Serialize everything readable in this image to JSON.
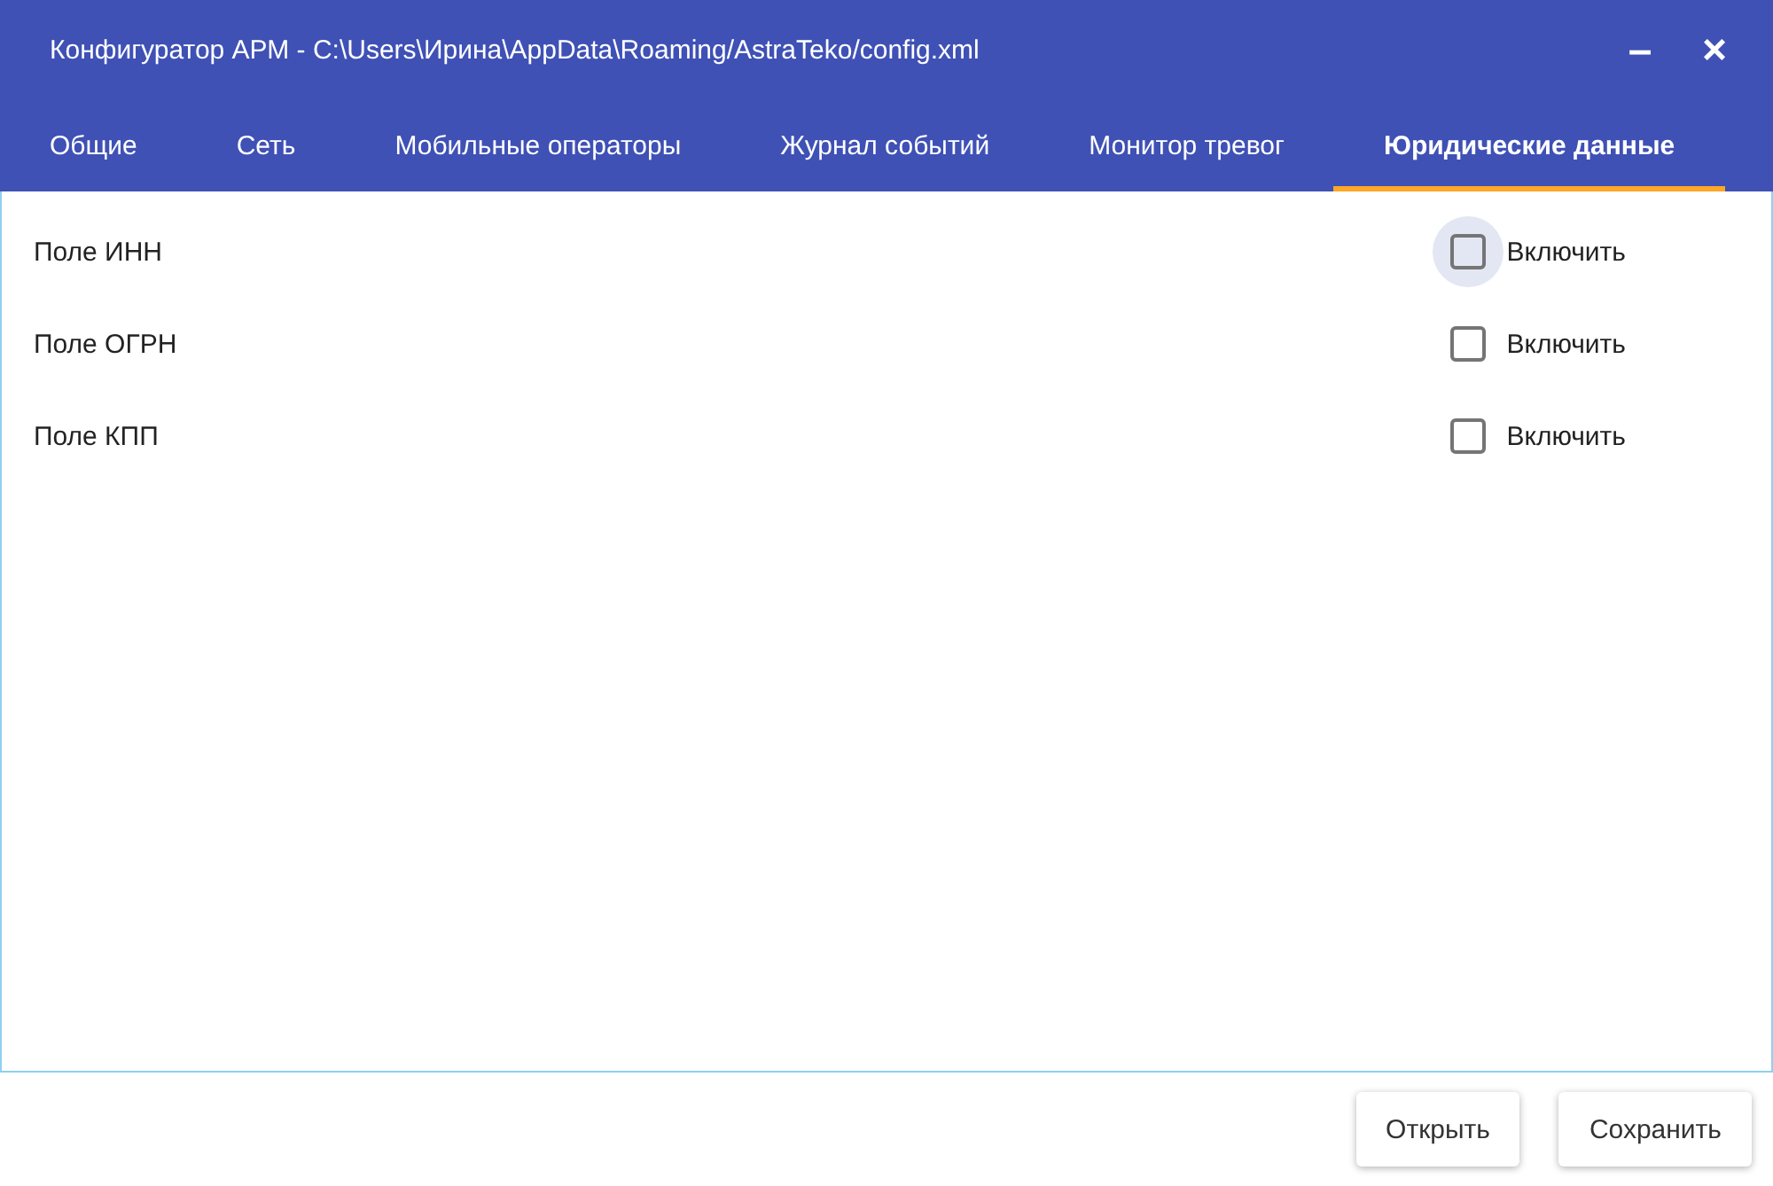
{
  "window": {
    "title": "Конфигуратор АРМ - C:\\Users\\Ирина\\AppData\\Roaming/AstraTeko/config.xml",
    "minimize": "–",
    "close": "×"
  },
  "tabs": [
    {
      "label": "Общие",
      "selected": false
    },
    {
      "label": "Сеть",
      "selected": false
    },
    {
      "label": "Мобильные операторы",
      "selected": false
    },
    {
      "label": "Журнал событий",
      "selected": false
    },
    {
      "label": "Монитор тревог",
      "selected": false
    },
    {
      "label": "Юридические данные",
      "selected": true
    }
  ],
  "fields": [
    {
      "label": "Поле ИНН",
      "option": "Включить",
      "checked": false,
      "focused": true
    },
    {
      "label": "Поле ОГРН",
      "option": "Включить",
      "checked": false,
      "focused": false
    },
    {
      "label": "Поле КПП",
      "option": "Включить",
      "checked": false,
      "focused": false
    }
  ],
  "buttons": [
    "Открыть",
    "Сохранить"
  ]
}
